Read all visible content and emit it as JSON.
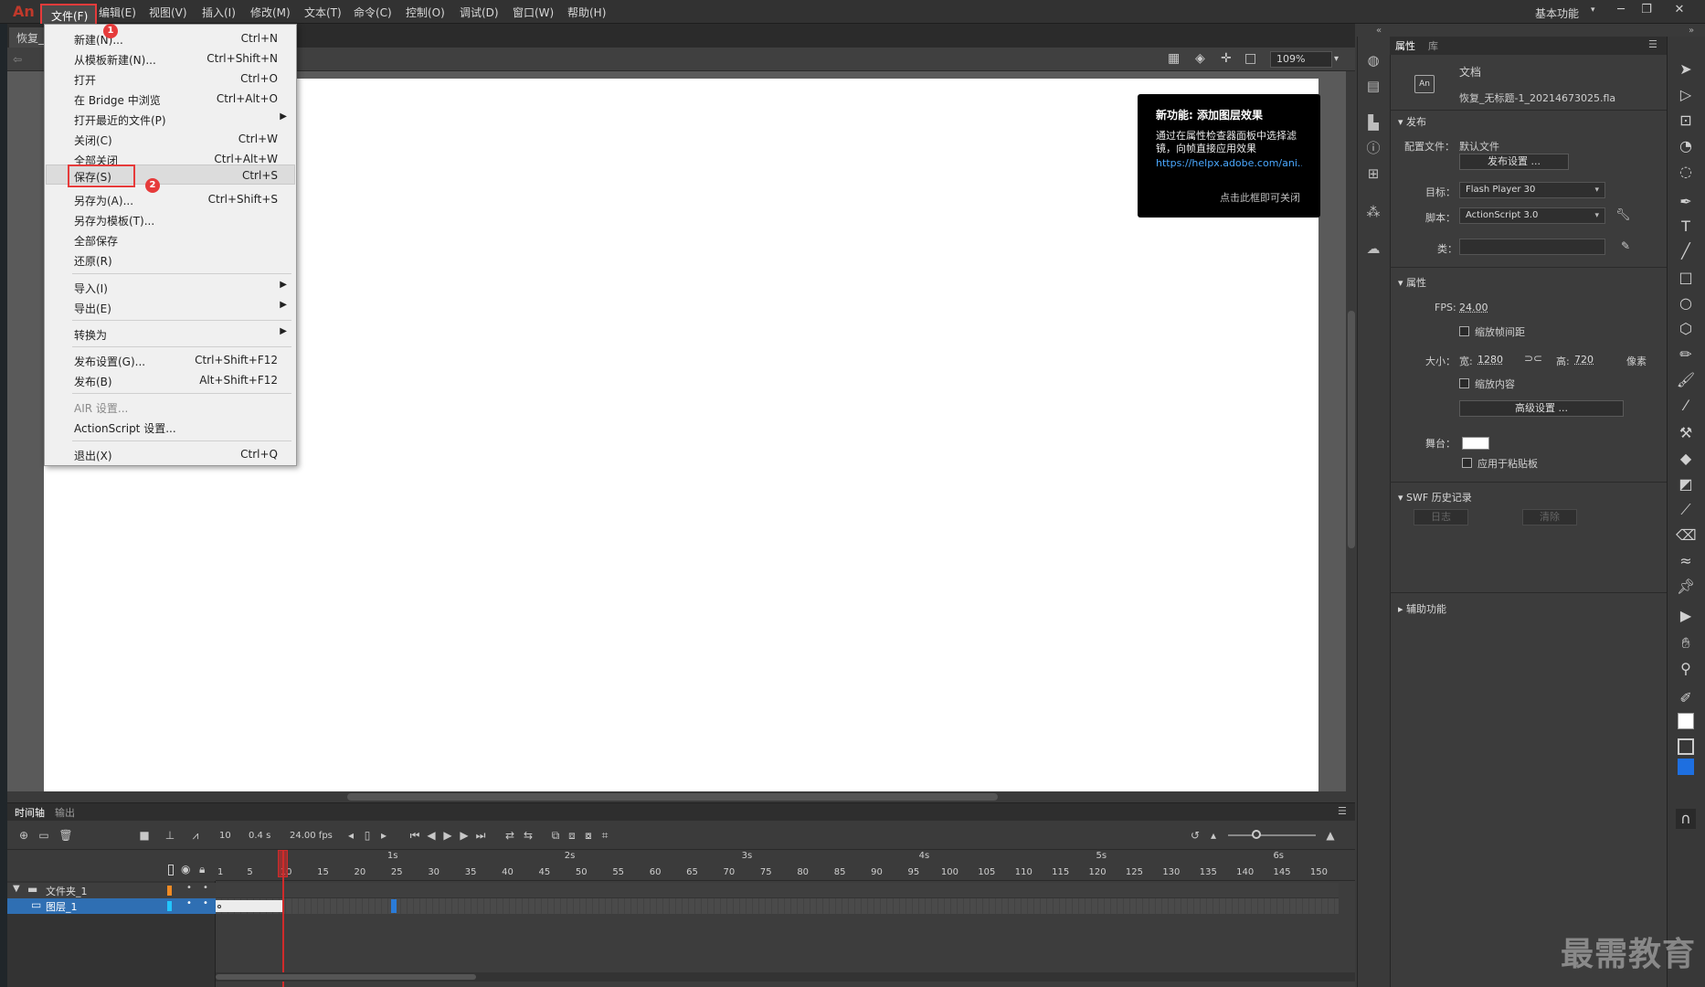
{
  "app": {
    "logo": "An",
    "workspace": "基本功能"
  },
  "menubar": {
    "items": [
      "文件(F)",
      "编辑(E)",
      "视图(V)",
      "插入(I)",
      "修改(M)",
      "文本(T)",
      "命令(C)",
      "控制(O)",
      "调试(D)",
      "窗口(W)",
      "帮助(H)"
    ]
  },
  "window_controls": {
    "minimize": "─",
    "restore": "❐",
    "close": "✕"
  },
  "doc_tab": {
    "label": "恢复_"
  },
  "edit_bar": {
    "zoom": "109%"
  },
  "file_menu": {
    "items": [
      {
        "label": "新建(N)...",
        "shortcut": "Ctrl+N"
      },
      {
        "label": "从模板新建(N)...",
        "shortcut": "Ctrl+Shift+N"
      },
      {
        "label": "打开",
        "shortcut": "Ctrl+O"
      },
      {
        "label": "在 Bridge 中浏览",
        "shortcut": "Ctrl+Alt+O"
      },
      {
        "label": "打开最近的文件(P)",
        "shortcut": "",
        "submenu": true
      },
      {
        "label": "关闭(C)",
        "shortcut": "Ctrl+W"
      },
      {
        "label": "全部关闭",
        "shortcut": "Ctrl+Alt+W"
      },
      {
        "label": "保存(S)",
        "shortcut": "Ctrl+S"
      },
      {
        "label": "另存为(A)...",
        "shortcut": "Ctrl+Shift+S"
      },
      {
        "label": "另存为模板(T)...",
        "shortcut": ""
      },
      {
        "label": "全部保存",
        "shortcut": ""
      },
      {
        "label": "还原(R)",
        "shortcut": ""
      },
      {
        "label": "导入(I)",
        "shortcut": "",
        "submenu": true
      },
      {
        "label": "导出(E)",
        "shortcut": "",
        "submenu": true
      },
      {
        "label": "转换为",
        "shortcut": "",
        "submenu": true
      },
      {
        "label": "发布设置(G)...",
        "shortcut": "Ctrl+Shift+F12"
      },
      {
        "label": "发布(B)",
        "shortcut": "Alt+Shift+F12"
      },
      {
        "label": "AIR 设置...",
        "shortcut": "",
        "disabled": true
      },
      {
        "label": "ActionScript 设置...",
        "shortcut": ""
      },
      {
        "label": "退出(X)",
        "shortcut": "Ctrl+Q"
      }
    ],
    "badges": [
      "1",
      "2"
    ]
  },
  "tooltip": {
    "title": "新功能: 添加图层效果",
    "desc": "通过在属性检查器面板中选择滤镜，向帧直接应用效果",
    "link": "https://helpx.adobe.com/ani...",
    "close": "点击此框即可关闭"
  },
  "props": {
    "tabs": [
      "属性",
      "库"
    ],
    "doc_label": "文档",
    "doc_icon": "An",
    "file_name": "恢复_无标题-1_20214673025.fla",
    "publish_section": "发布",
    "profile_label": "配置文件：",
    "profile_value": "默认文件",
    "publish_settings_btn": "发布设置 ...",
    "target_label": "目标：",
    "target_value": "Flash Player 30",
    "script_label": "脚本：",
    "script_value": "ActionScript 3.0",
    "class_label": "类：",
    "attr_section": "属性",
    "fps_label": "FPS:",
    "fps_value": "24.00",
    "scale_spans": "缩放帧间距",
    "size_label": "大小：",
    "width_label": "宽:",
    "width_value": "1280",
    "height_label": "高:",
    "height_value": "720",
    "unit": "像素",
    "scale_content": "缩放内容",
    "advanced_btn": "高级设置 ...",
    "stage_label": "舞台：",
    "apply_pasteboard": "应用于粘贴板",
    "swf_section": "SWF 历史记录",
    "log_btn": "日志",
    "clear_btn": "清除",
    "access_section": "辅助功能"
  },
  "timeline": {
    "tabs": [
      "时间轴",
      "输出"
    ],
    "frame": "10",
    "time": "0.4 s",
    "fps": "24.00 fps",
    "seconds": [
      "1s",
      "2s",
      "3s",
      "4s",
      "5s",
      "6s"
    ],
    "frame_ticks": [
      "1",
      "5",
      "10",
      "15",
      "20",
      "25",
      "30",
      "35",
      "40",
      "45",
      "50",
      "55",
      "60",
      "65",
      "70",
      "75",
      "80",
      "85",
      "90",
      "95",
      "100",
      "105",
      "110",
      "115",
      "120",
      "125",
      "130",
      "135",
      "140",
      "145",
      "150"
    ],
    "layers": [
      {
        "name": "文件夹_1",
        "color": "#f08a24"
      },
      {
        "name": "图层_1",
        "color": "#22c5ff"
      }
    ]
  },
  "watermark": "最需教育"
}
